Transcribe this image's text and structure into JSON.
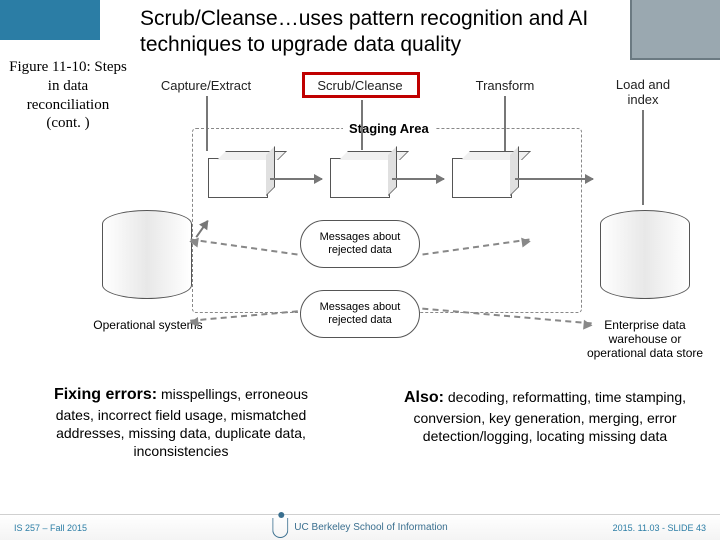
{
  "header": {
    "title": "Scrub/Cleanse…uses pattern recognition and AI techniques to upgrade data quality"
  },
  "figure": {
    "caption": "Figure 11-10: Steps in data reconciliation (cont. )"
  },
  "diagram": {
    "steps": {
      "capture": "Capture/Extract",
      "scrub": "Scrub/Cleanse",
      "transform": "Transform",
      "load": "Load and index"
    },
    "staging_label": "Staging Area",
    "clouds": {
      "top": "Messages about rejected data",
      "bottom": "Messages about rejected data"
    },
    "db_labels": {
      "left": "Operational systems",
      "right": "Enterprise data warehouse or operational data store"
    }
  },
  "descriptions": {
    "left": {
      "lead": "Fixing errors:",
      "rest": " misspellings, erroneous dates, incorrect field usage, mismatched addresses, missing data, duplicate data, inconsistencies"
    },
    "right": {
      "lead": "Also:",
      "rest": " decoding, reformatting, time stamping, conversion, key generation, merging, error detection/logging, locating missing data"
    }
  },
  "footer": {
    "left": "IS 257 – Fall 2015",
    "center": "UC Berkeley School of Information",
    "right": "2015. 11.03 - SLIDE 43"
  }
}
